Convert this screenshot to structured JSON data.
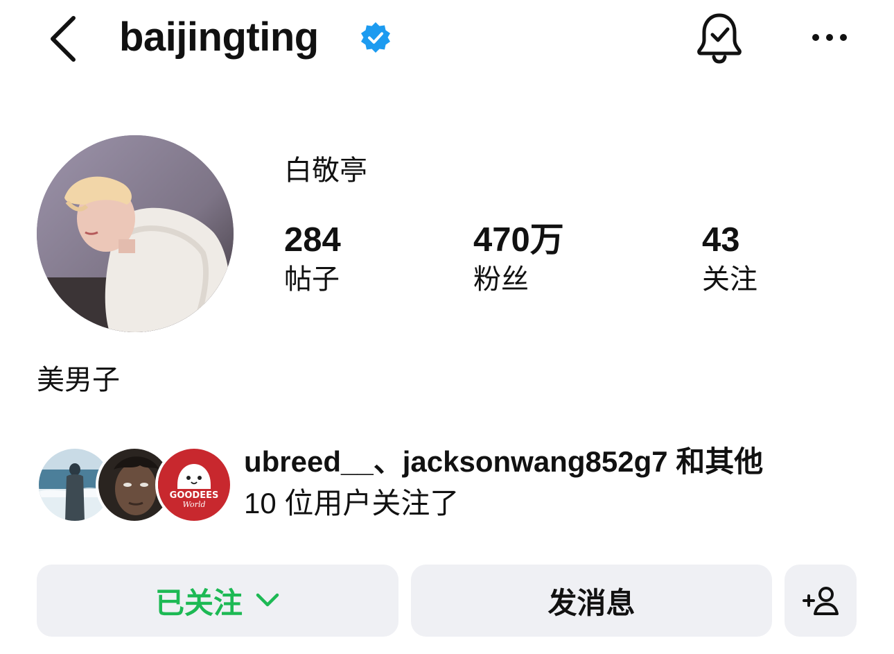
{
  "header": {
    "username": "baijingting",
    "verified_icon": "verified-badge-icon",
    "back_icon": "chevron-left-icon",
    "bell_icon": "bell-check-icon",
    "more_icon": "more-horizontal-icon"
  },
  "profile": {
    "display_name": "白敬亭",
    "stats": [
      {
        "value": "284",
        "label": "帖子"
      },
      {
        "value": "470万",
        "label": "粉丝"
      },
      {
        "value": "43",
        "label": "关注"
      }
    ],
    "bio": "美男子"
  },
  "mutual": {
    "line1": "ubreed__、jacksonwang852g7 和其他",
    "line2": "10 位用户关注了",
    "avatar3_text_top": "GOODEES",
    "avatar3_text_bottom": "World"
  },
  "actions": {
    "following_label": "已关注",
    "message_label": "发消息",
    "add_icon": "add-person-icon"
  },
  "colors": {
    "verified": "#1d9bf0",
    "following_text": "#1db954",
    "button_bg": "#eff0f4"
  }
}
